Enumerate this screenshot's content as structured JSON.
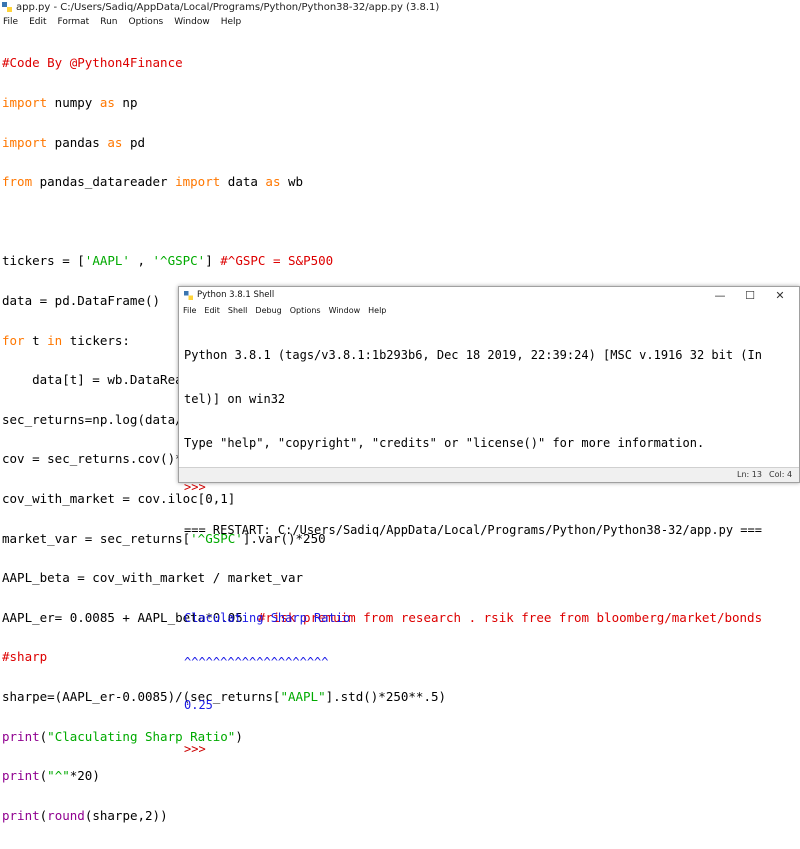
{
  "editor": {
    "title": "app.py - C:/Users/Sadiq/AppData/Local/Programs/Python/Python38-32/app.py (3.8.1)",
    "menu": [
      "File",
      "Edit",
      "Format",
      "Run",
      "Options",
      "Window",
      "Help"
    ],
    "code_lines": [
      "#Code By @Python4Finance",
      "import numpy as np",
      "import pandas as pd",
      "from pandas_datareader import data as wb",
      "",
      "tickers = ['AAPL' , '^GSPC'] #^GSPC = S&P500",
      "data = pd.DataFrame()",
      "for t in tickers:",
      "    data[t] = wb.DataReader(t,data_source = 'yahoo' ,start = '2015-01-01',end='2019-12-29')['Adj Close']",
      "sec_returns=np.log(data/data.shift(1))",
      "cov = sec_returns.cov()*250",
      "cov_with_market = cov.iloc[0,1]",
      "market_var = sec_returns['^GSPC'].var()*250",
      "AAPL_beta = cov_with_market / market_var",
      "AAPL_er= 0.0085 + AAPL_beta*0.05  #risk premuim from research . rsik free from bloomberg/market/bonds",
      "#sharp",
      "sharpe=(AAPL_er-0.0085)/(sec_returns[\"AAPL\"].std()*250**.5)",
      "print(\"Claculating Sharp Ratio\")",
      "print(\"^\"*20)",
      "print(round(sharpe,2))"
    ]
  },
  "shell": {
    "title": "Python 3.8.1 Shell",
    "menu": [
      "File",
      "Edit",
      "Shell",
      "Debug",
      "Options",
      "Window",
      "Help"
    ],
    "controls": {
      "minimize": "—",
      "maximize": "☐",
      "close": "✕"
    },
    "lines": {
      "banner1": "Python 3.8.1 (tags/v3.8.1:1b293b6, Dec 18 2019, 22:39:24) [MSC v.1916 32 bit (In",
      "banner2": "tel)] on win32",
      "banner3": "Type \"help\", \"copyright\", \"credits\" or \"license()\" for more information.",
      "prompt1": ">>> ",
      "restart": "=== RESTART: C:/Users/Sadiq/AppData/Local/Programs/Python/Python38-32/app.py ===",
      "blank": "",
      "out1": "Claculating Sharp Ratio",
      "out2": "^^^^^^^^^^^^^^^^^^^^",
      "out3": "0.25",
      "prompt2": ">>> "
    },
    "status": {
      "line": "Ln: 13",
      "col": "Col: 4"
    }
  },
  "colors": {
    "keyword": "#ff7700",
    "comment": "#dd0000",
    "string": "#00aa00",
    "builtin": "#900090",
    "output": "#1a1ae6"
  }
}
